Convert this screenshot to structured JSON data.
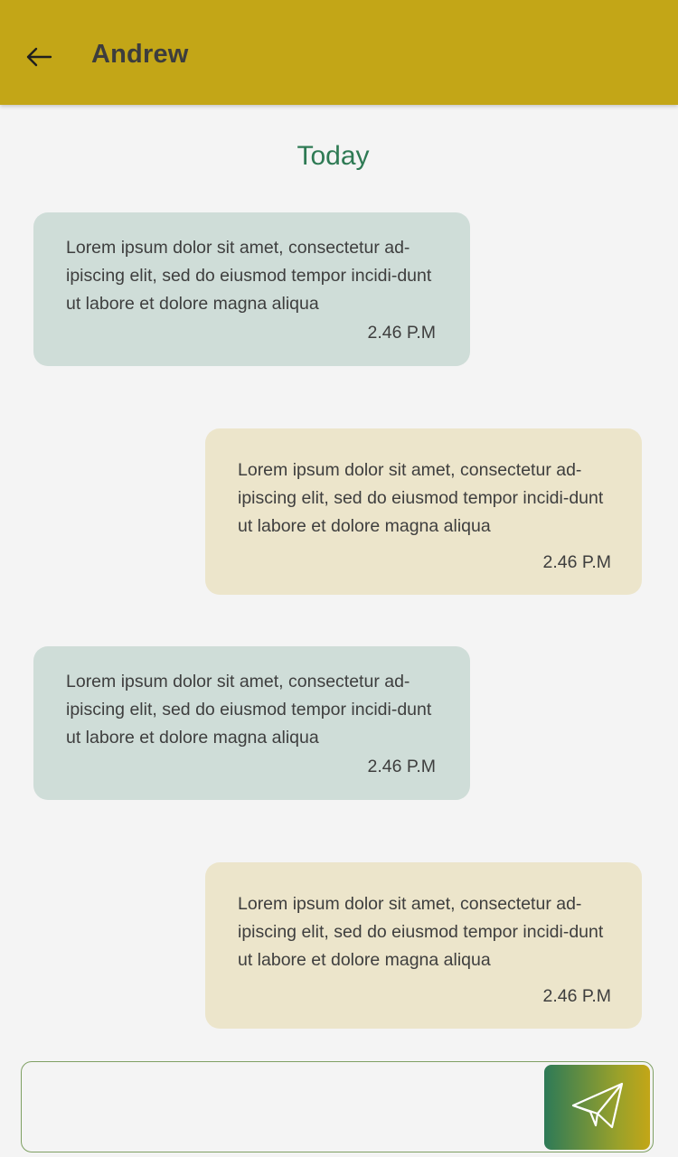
{
  "header": {
    "title": "Andrew",
    "back_icon": "arrow-left-icon"
  },
  "conversation": {
    "day_label": "Today",
    "messages": [
      {
        "direction": "incoming",
        "text": "Lorem ipsum dolor sit amet, consectetur ad-ipiscing elit, sed do eiusmod tempor incidi-dunt ut labore et dolore magna aliqua",
        "time": "2.46 P.M"
      },
      {
        "direction": "outgoing",
        "text": "Lorem ipsum dolor sit amet, consectetur ad-ipiscing elit, sed do eiusmod tempor incidi-dunt ut labore et dolore magna aliqua",
        "time": "2.46 P.M"
      },
      {
        "direction": "incoming",
        "text": "Lorem ipsum dolor sit amet, consectetur ad-ipiscing elit, sed do eiusmod tempor incidi-dunt ut labore et dolore magna aliqua",
        "time": "2.46 P.M"
      },
      {
        "direction": "outgoing",
        "text": "Lorem ipsum dolor sit amet, consectetur ad-ipiscing elit, sed do eiusmod tempor incidi-dunt ut labore et dolore magna aliqua",
        "time": "2.46 P.M"
      }
    ]
  },
  "composer": {
    "value": "",
    "placeholder": "",
    "send_icon": "paper-plane-icon"
  },
  "colors": {
    "app_bar": "#c3a617",
    "accent_green": "#2e7a54",
    "incoming_bubble": "#cfddd8",
    "outgoing_bubble": "#ece5cb",
    "background": "#f4f4f4"
  }
}
